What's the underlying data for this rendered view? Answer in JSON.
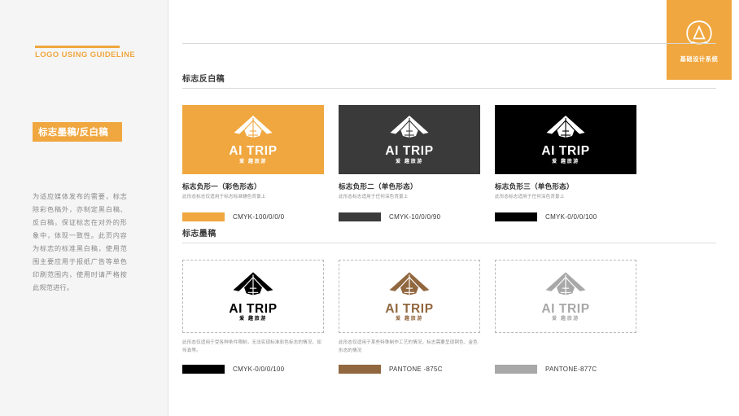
{
  "sidebar": {
    "eyebrow": "LOGO USING GUIDELINE",
    "badge": "标志墨稿/反白稿",
    "body": "为适应媒体发布的需要，标志除彩色稿外，亦制定黑白稿、反白稿，保证标志在对外的形象中，体现一致性。此页内容为标志的标准黑白稿，使用范围主要应用于报纸广告等单色印刷范围内，使用时请严格按此规范进行。",
    "accent_color": "#f0a73f"
  },
  "corner": {
    "label": "基础设计系统",
    "icon": "circle-a-monogram-icon",
    "background": "#f0a73f"
  },
  "logo": {
    "wordmark": "AI TRIP",
    "subtext": "爱 趣旅游",
    "mark": "glider-aircraft-icon"
  },
  "sections": [
    {
      "title": "标志反白稿",
      "cards": [
        {
          "bg": "#f0a73f",
          "logo_color": "#ffffff",
          "title": "标志负形一（彩色形态）",
          "desc": "此形态标志仅适用于标志标准辅色背景上",
          "chip_color": "#f0a73f",
          "chip_label": "CMYK-100/0/0/0"
        },
        {
          "bg": "#3a3a3a",
          "logo_color": "#ffffff",
          "title": "标志负形二（单色形态）",
          "desc": "此形态标志适用于任何深色背景上",
          "chip_color": "#3a3a3a",
          "chip_label": "CMYK-10/0/0/90"
        },
        {
          "bg": "#000000",
          "logo_color": "#ffffff",
          "title": "标志负形三（单色形态）",
          "desc": "此形态标志适用于任何深色背景上",
          "chip_color": "#000000",
          "chip_label": "CMYK-0/0/0/100"
        }
      ]
    },
    {
      "title": "标志墨稿",
      "cards": [
        {
          "bg": "#ffffff",
          "logo_color": "#000000",
          "desc": "此形态仅适用于受各种条件限制，无法实现标准彩色标志的情况，如传真等。",
          "chip_color": "#000000",
          "chip_label": "CMYK-0/0/0/100"
        },
        {
          "bg": "#ffffff",
          "logo_color": "#91673f",
          "desc": "此形态仅适用于某些特殊制作工艺的情况，标志需要呈现铜色、金色形态的情况",
          "chip_color": "#91673f",
          "chip_label": "PANTONE -875C"
        },
        {
          "bg": "#ffffff",
          "logo_color": "#a8a8a8",
          "desc": "",
          "chip_color": "#a8a8a8",
          "chip_label": "PANTONE-877C"
        }
      ]
    }
  ]
}
